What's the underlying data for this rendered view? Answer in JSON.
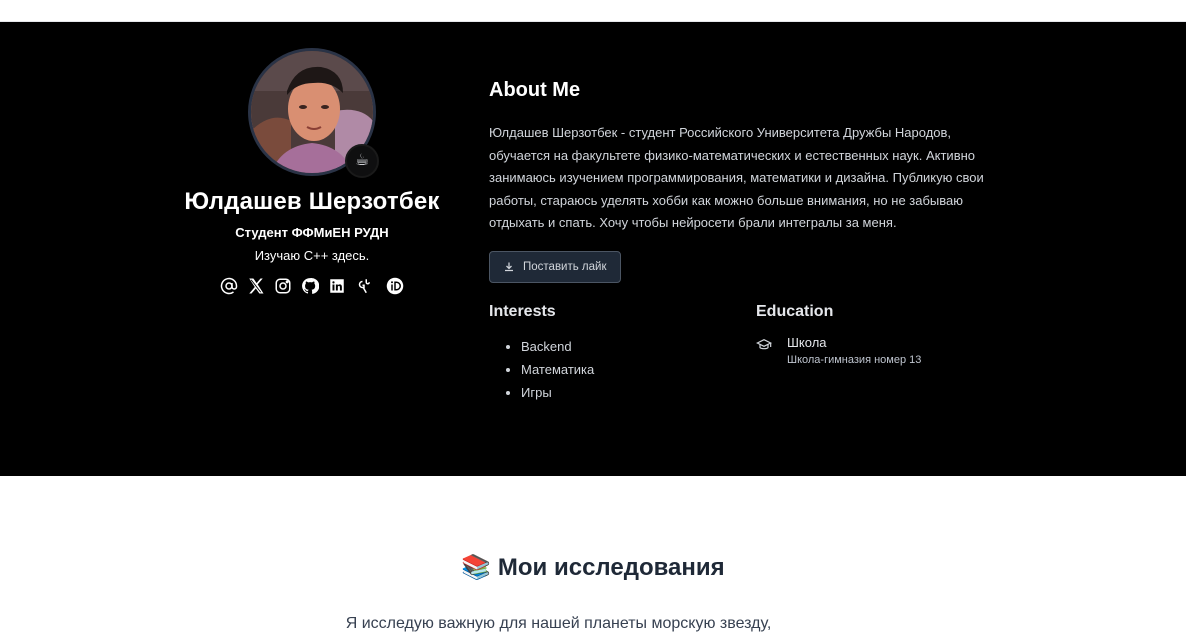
{
  "profile": {
    "avatar_emoji": "☕",
    "name": "Юлдашев Шерзотбек",
    "role": "Студент ФФМиЕН РУДН",
    "tagline": "Изучаю C++ здесь.",
    "socials": [
      "email-icon",
      "x-twitter-icon",
      "instagram-icon",
      "github-icon",
      "linkedin-icon",
      "researchgate-icon",
      "orcid-icon"
    ]
  },
  "about": {
    "title": "About Me",
    "text": "Юлдашев Шерзотбек - студент Российского Университета Дружбы Народов, обучается на факультете физико-математических и естественных наук. Активно занимаюсь изучением программирования, математики и дизайна. Публикую свои работы, стараюсь уделять хобби как можно больше внимания, но не забываю отдыхать и спать. Хочу чтобы нейросети брали интегралы за меня.",
    "like_button": "Поставить лайк"
  },
  "interests": {
    "title": "Interests",
    "items": [
      "Backend",
      "Математика",
      "Игры"
    ]
  },
  "education": {
    "title": "Education",
    "school": "Школа",
    "description": "Школа-гимназия номер 13"
  },
  "research": {
    "emoji": "📚",
    "title": "Мои исследования",
    "intro": "Я исследую важную для нашей планеты морскую звезду,"
  },
  "colors": {
    "hero_bg": "#000000",
    "page_bg": "#ffffff",
    "button_bg": "#1f2937"
  }
}
